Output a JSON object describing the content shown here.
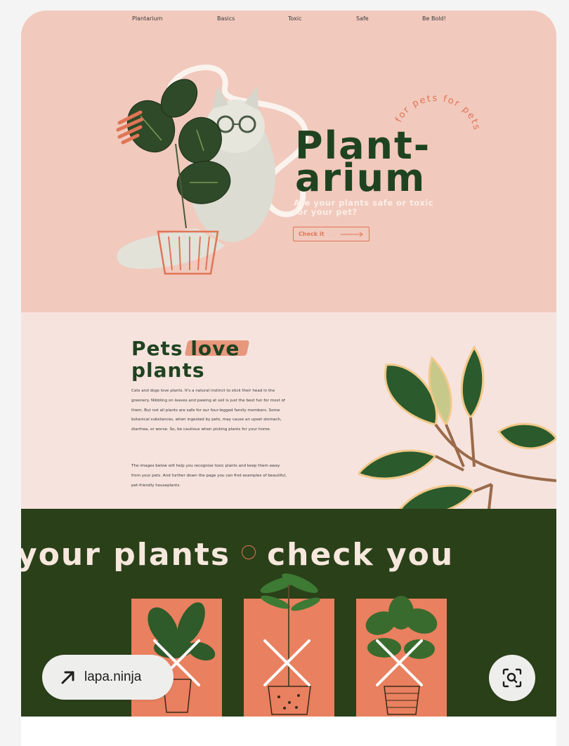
{
  "nav": [
    "Plantarium",
    "Basics",
    "Toxic",
    "Safe",
    "Be Bold!"
  ],
  "hero": {
    "title_line1": "Plant-",
    "title_line2": "arium",
    "curved_text": "for pets for pets",
    "tagline": "Are your plants safe or toxic for your pet?",
    "cta_label": "Check it"
  },
  "intro": {
    "heading_part1": "Pets ",
    "heading_highlight": "love",
    "heading_line2": "plants",
    "paragraph1": "Cats and dogs love plants. It's a natural instinct to stick their head in the greenery. Nibbling on leaves and pawing at soil is just the best fun for most of them. But not all plants are safe for our four-legged family members. Some botanical substances, when ingested by pets, may cause an upset stomach, diarrhea, or worse. So, be cautious when picking plants for your home.",
    "paragraph2": "The images below will help you recognise toxic plants and keep them away from your pets. And further down the page you can find examples of beautiful, pet-friendly houseplants."
  },
  "marquee": {
    "text_left": "your plants",
    "text_right": "check you"
  },
  "source": {
    "label": "lapa.ninja"
  },
  "colors": {
    "hero_bg": "#f1c9bd",
    "intro_bg": "#f6e3dd",
    "dark_green": "#2a4019",
    "title_green": "#1f4320",
    "accent_coral": "#e07556",
    "tile_coral": "#e9805f"
  },
  "icons": [
    "arrow-up-right-icon",
    "lens-search-icon",
    "arrow-right-icon",
    "down-circle-icon",
    "cross-icon"
  ]
}
